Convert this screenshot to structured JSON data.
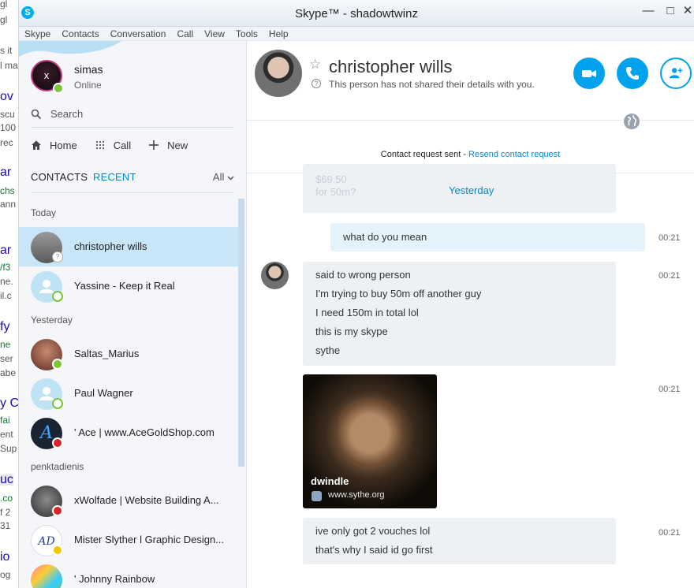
{
  "window": {
    "app_icon": "S",
    "title": "Skype™ - shadowtwinz",
    "minimize_icon": "minimize-icon",
    "maximize_icon": "maximize-icon",
    "close_icon": "close-icon"
  },
  "menu": [
    "Skype",
    "Contacts",
    "Conversation",
    "Call",
    "View",
    "Tools",
    "Help"
  ],
  "me": {
    "avatar_text": "x",
    "name": "simas",
    "status": "Online"
  },
  "search": {
    "placeholder": "Search"
  },
  "nav": {
    "home": "Home",
    "call": "Call",
    "new": "New"
  },
  "tabs": {
    "contacts": "CONTACTS",
    "recent": "RECENT",
    "filter": "All"
  },
  "contacts": {
    "sections": [
      {
        "title": "Today",
        "items": [
          {
            "name": "christopher wills",
            "status": "unknown",
            "selected": true
          },
          {
            "name": "Yassine - Keep it Real",
            "status": "online-ring"
          }
        ]
      },
      {
        "title": "Yesterday",
        "items": [
          {
            "name": "Saltas_Marius",
            "status": "online"
          },
          {
            "name": "Paul Wagner",
            "status": "online-ring"
          },
          {
            "name": "' Ace | www.AceGoldShop.com",
            "status": "dnd"
          }
        ]
      },
      {
        "title": "penktadienis",
        "items": [
          {
            "name": "xWolfade | Website Building A...",
            "status": "dnd"
          },
          {
            "name": "Mister Slyther l Graphic Design...",
            "status": "away"
          },
          {
            "name": "' Johnny Rainbow",
            "status": "none"
          }
        ]
      }
    ]
  },
  "conversation": {
    "contact_name": "christopher wills",
    "contact_sub": "This person has not shared their details with you.",
    "request_text": "Contact request sent - ",
    "resend_text": "Resend contact request",
    "day_label": "Yesterday",
    "faded_lines": [
      "$69.50",
      "for 50m?"
    ],
    "messages": [
      {
        "lines": [
          "what do you mean"
        ],
        "time": "00:21",
        "outgoing": true
      },
      {
        "lines": [
          "said to wrong person",
          "I'm trying to buy 50m off another guy",
          "I need 150m in total lol",
          "this is my skype",
          "sythe"
        ],
        "time": "00:21"
      },
      {
        "card_title": "dwindle",
        "card_site": "www.sythe.org",
        "time": "00:21"
      },
      {
        "lines": [
          "ive only got 2 vouches lol",
          "that's why I said id go first"
        ],
        "time": "00:21"
      }
    ]
  },
  "background_page": {
    "snippets": [
      "gl",
      "s it",
      "l ma",
      "ov",
      "scu",
      "100",
      "rec",
      "ar",
      "chs",
      "ann",
      "ar",
      "/f3",
      "ne.",
      "il.c",
      "fy",
      "ne",
      "ser",
      "abe",
      "y C",
      "fai",
      "ent",
      "Sup",
      "uc",
      ".co",
      "f 2",
      "31",
      "io",
      "og"
    ]
  },
  "colors": {
    "accent": "#00a2ed",
    "link": "#0d86c4",
    "selected_row": "#c8e6f8"
  }
}
